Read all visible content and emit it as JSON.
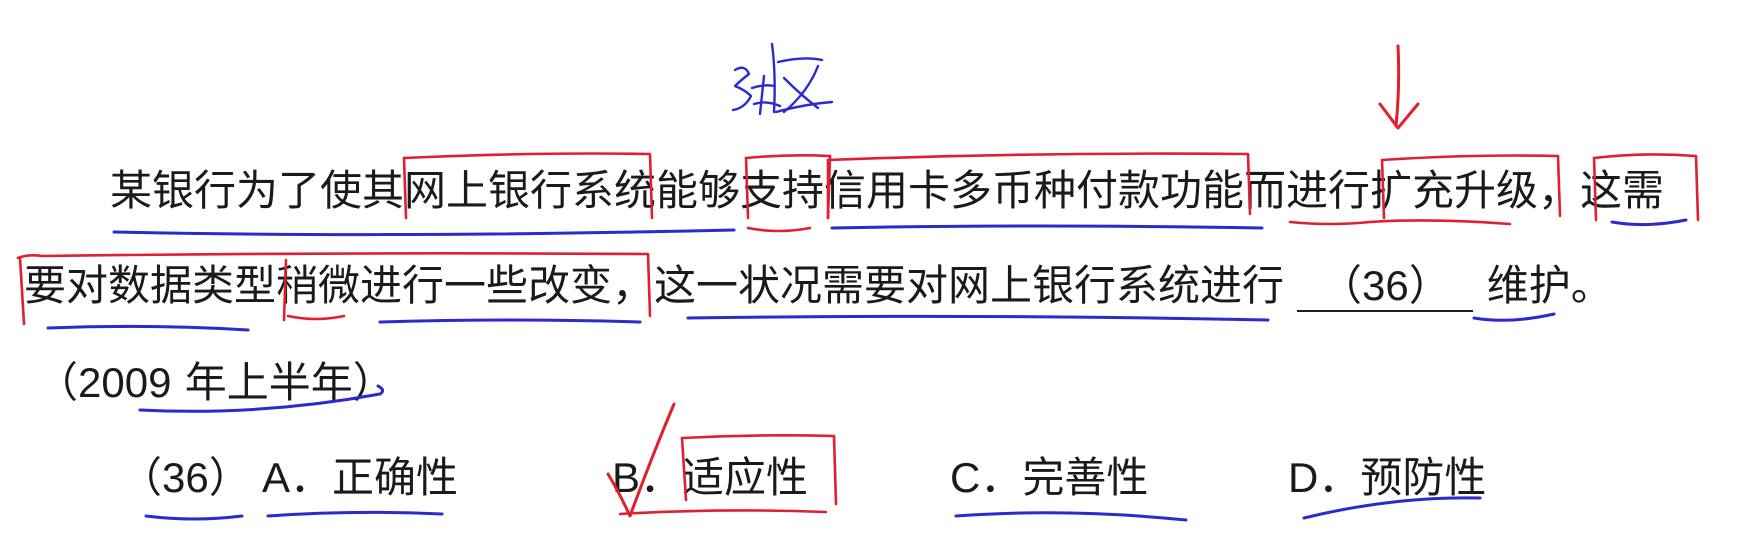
{
  "question": {
    "line1": "某银行为了使其网上银行系统能够支持信用卡多币种付款功能而进行扩充升级，这需",
    "line2_before": "要对数据类型稍微进行一些改变，这一状况需要对网上银行系统进行",
    "blank_label": "（36）",
    "line2_after": "维护。",
    "source_open": "（",
    "source_year": "2009",
    "source_text": " 年上半年）"
  },
  "options": {
    "number": "（36）",
    "a": {
      "letter": "A．",
      "text": "正确性"
    },
    "b": {
      "letter": "B．",
      "text": "适应性"
    },
    "c": {
      "letter": "C．",
      "text": "完善性"
    },
    "d": {
      "letter": "D．",
      "text": "预防性"
    }
  },
  "annotations": {
    "ink_red": "#e0202f",
    "ink_blue": "#2a2ad0",
    "handwritten_note_color": "#2a2ad0",
    "correct_option": "B"
  }
}
